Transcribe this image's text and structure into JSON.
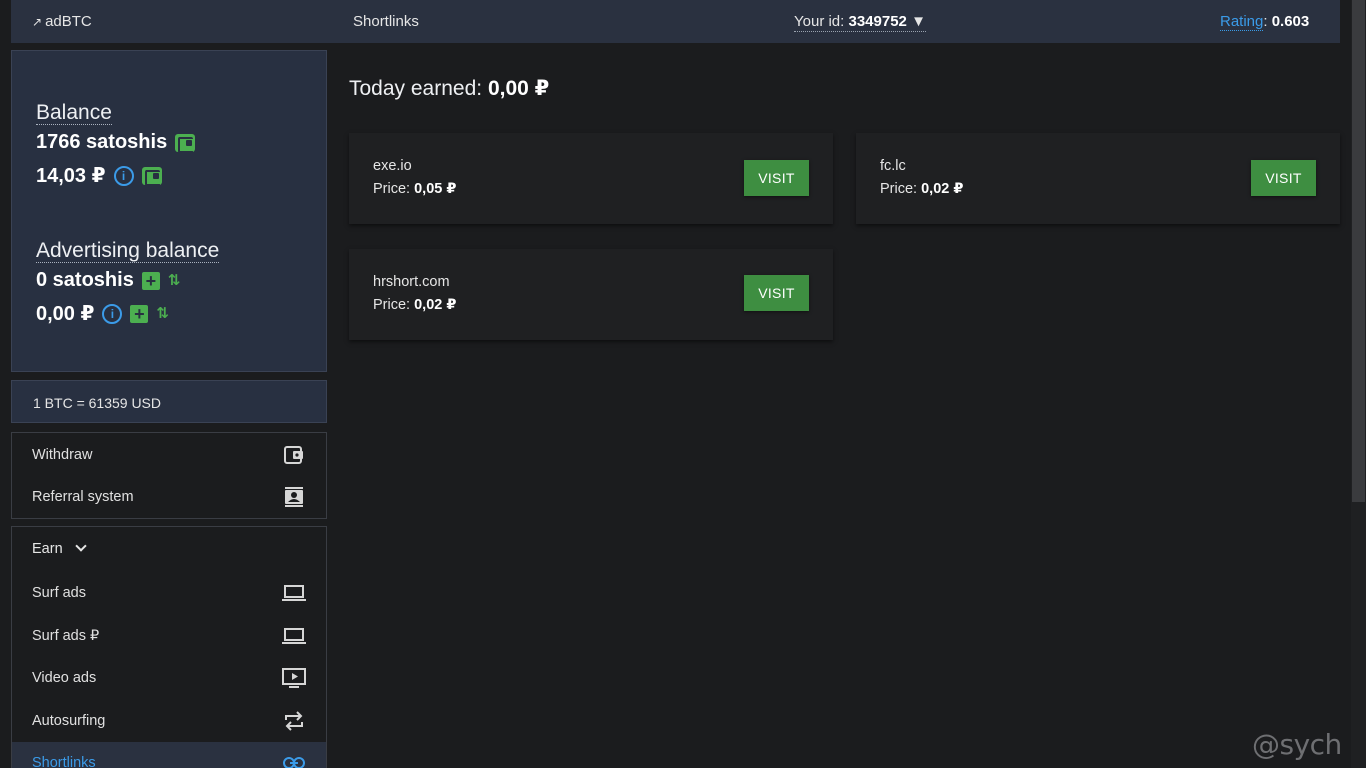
{
  "header": {
    "brand": "adBTC",
    "brand_arrow": "↗",
    "nav_title": "Shortlinks",
    "user_id_label": "Your id:",
    "user_id_value": "3349752",
    "user_id_caret": "▼",
    "rating_label": "Rating",
    "rating_value": "0.603"
  },
  "balance": {
    "heading": "Balance",
    "satoshis": "1766 satoshis",
    "rub": "14,03 ₽"
  },
  "advertising": {
    "heading": "Advertising balance",
    "satoshis": "0 satoshis",
    "rub": "0,00 ₽"
  },
  "rate": {
    "text": "1 BTC = 61359 USD"
  },
  "menu_account": [
    {
      "label": "Withdraw",
      "icon": "wallet-icon"
    },
    {
      "label": "Referral system",
      "icon": "contact-card-icon"
    }
  ],
  "earn": {
    "label": "Earn",
    "items": [
      {
        "label": "Surf ads",
        "icon": "laptop-icon"
      },
      {
        "label": "Surf ads ₽",
        "icon": "laptop-icon"
      },
      {
        "label": "Video ads",
        "icon": "video-play-icon"
      },
      {
        "label": "Autosurfing",
        "icon": "repeat-icon"
      },
      {
        "label": "Shortlinks",
        "icon": "link-icon",
        "active": true
      }
    ]
  },
  "main": {
    "today_label": "Today earned:",
    "today_value": "0,00 ₽",
    "price_label": "Price:",
    "visit_label": "VISIT",
    "cards": [
      {
        "site": "exe.io",
        "price": "0,05 ₽"
      },
      {
        "site": "fc.lc",
        "price": "0,02 ₽"
      },
      {
        "site": "hrshort.com",
        "price": "0,02 ₽"
      }
    ]
  },
  "watermark": "@sych",
  "colors": {
    "topbar_bg": "#2a3140",
    "accent_blue": "#3b9be8",
    "accent_green": "#4caf50",
    "button_green": "#3e8e41",
    "page_bg": "#1b1c1e"
  }
}
